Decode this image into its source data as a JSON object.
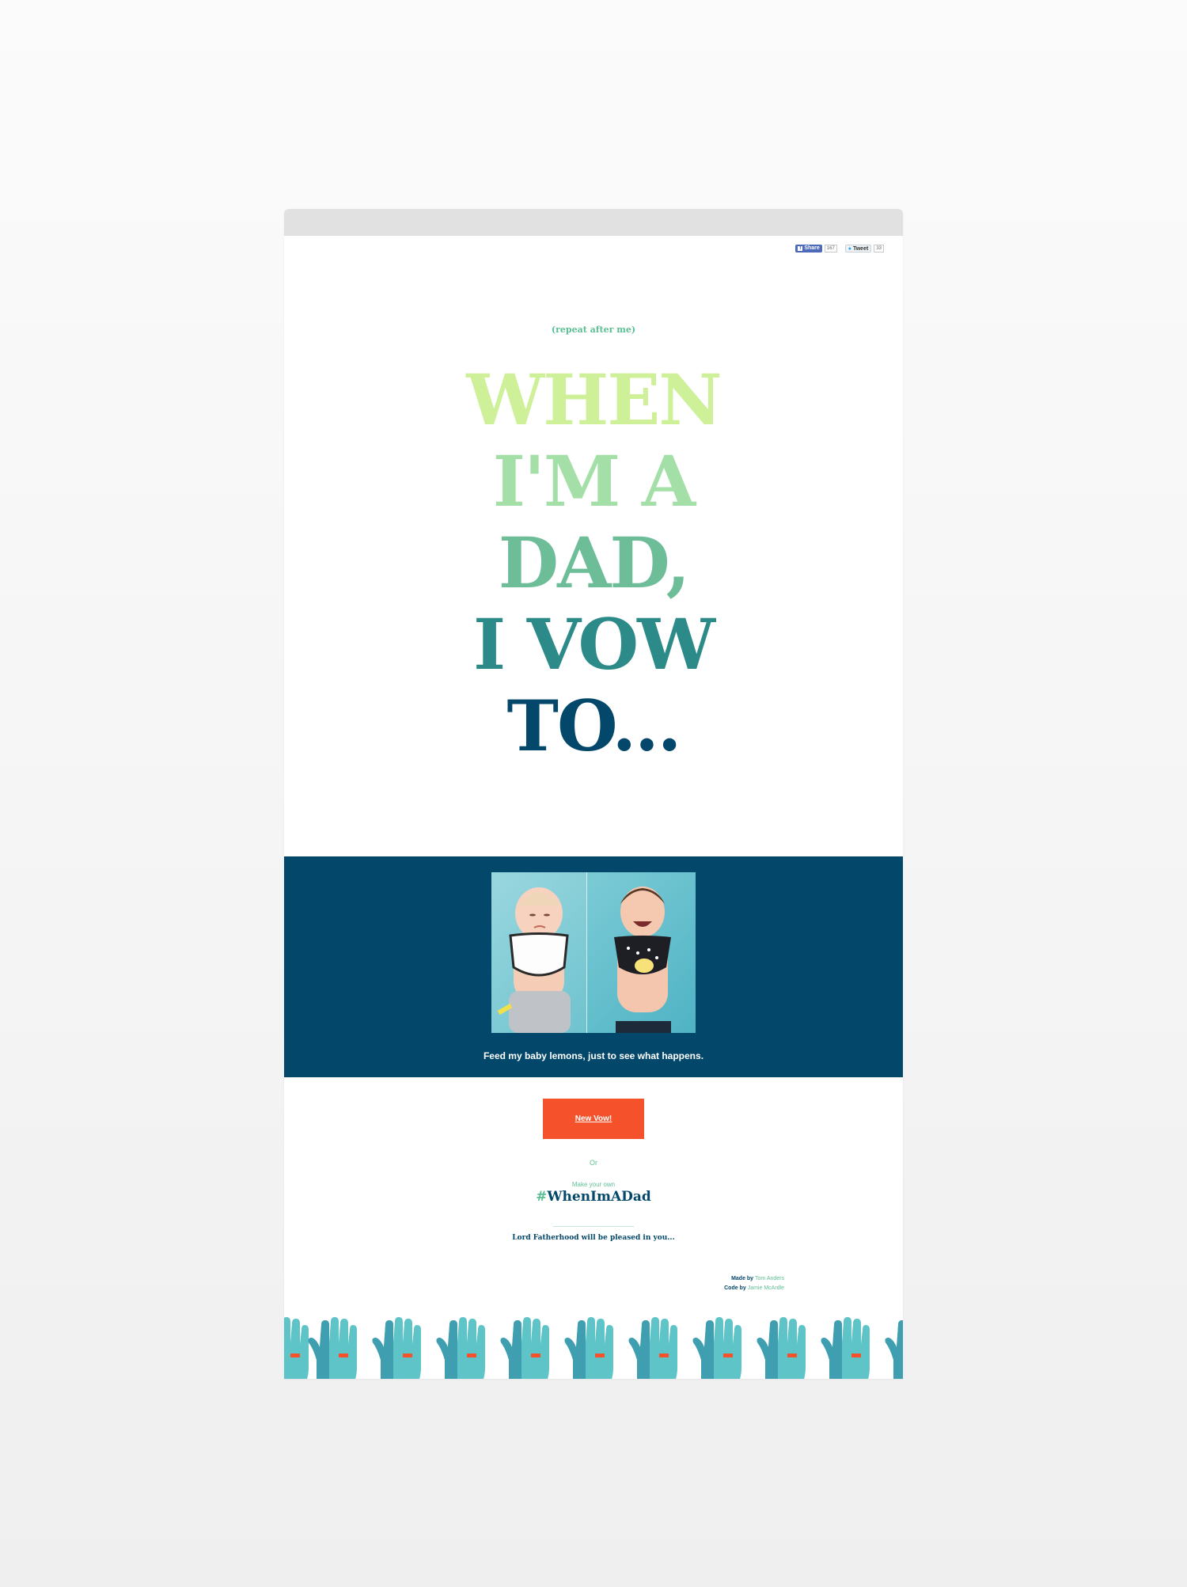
{
  "social": {
    "share_label": "Share",
    "share_count": "167",
    "tweet_label": "Tweet",
    "tweet_count": "33"
  },
  "hero": {
    "kicker": "(repeat after me)",
    "lines": [
      {
        "text": "WHEN",
        "color": "#cdf098"
      },
      {
        "text": "I'M A",
        "color": "#a3dfa7"
      },
      {
        "text": "DAD,",
        "color": "#6cbd98"
      },
      {
        "text": "I VOW",
        "color": "#2c8a88"
      },
      {
        "text": "TO...",
        "color": "#03486a"
      }
    ]
  },
  "vow": {
    "caption": "Feed my baby lemons, just to see what happens."
  },
  "actions": {
    "new_vow_label": "New Vow!",
    "or_label": "Or",
    "make_own_label": "Make your own",
    "hashtag_symbol": "#",
    "hashtag_text": "WhenImADad",
    "blessing": "Lord Fatherhood will be pleased in you..."
  },
  "credits": {
    "made_by_prefix": "Made by",
    "made_by_name": "Tom Anders",
    "code_by_prefix": "Code by",
    "code_by_name": "Jamie McArdle"
  },
  "colors": {
    "navy": "#03486a",
    "green": "#5cbf93",
    "orange": "#f5522c",
    "teal": "#5ec4c7"
  }
}
